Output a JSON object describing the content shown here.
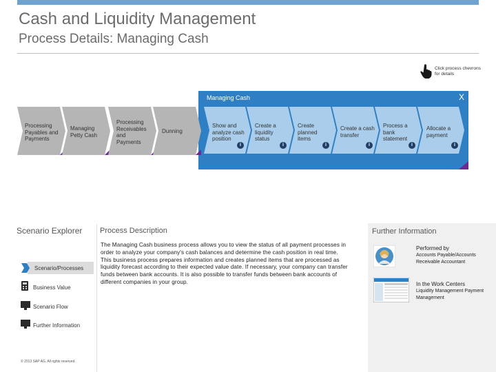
{
  "header": {
    "title": "Cash and Liquidity Management",
    "subtitle": "Process Details: Managing Cash",
    "hint": "Click process chevrons for details"
  },
  "process_band": {
    "title": "Managing Cash",
    "close": "X"
  },
  "outer_chevrons": [
    {
      "label": "Processing Payables and Payments"
    },
    {
      "label": "Managing Petty Cash"
    },
    {
      "label": "Processing Receivables and Payments"
    },
    {
      "label": "Dunning"
    }
  ],
  "inner_chevrons": [
    {
      "label": "Show and analyze cash position",
      "info": "i"
    },
    {
      "label": "Create a liquidity status",
      "info": "i"
    },
    {
      "label": "Create planned items",
      "info": "i"
    },
    {
      "label": "Create a cash transfer",
      "info": "i"
    },
    {
      "label": "Process a bank statement",
      "info": "i"
    },
    {
      "label": "Allocate a payment",
      "info": "i"
    }
  ],
  "sidebar": {
    "title": "Scenario Explorer",
    "items": [
      {
        "label": "Scenario/Processes",
        "icon": "scenario-processes-icon"
      },
      {
        "label": "Business Value",
        "icon": "calculator-icon"
      },
      {
        "label": "Scenario Flow",
        "icon": "monitor-icon"
      },
      {
        "label": "Further Information",
        "icon": "info-screen-icon"
      }
    ],
    "copyright": "© 2013 SAP AG. All rights reserved."
  },
  "description": {
    "title": "Process Description",
    "body": "The Managing Cash business process allows you to view the status of all payment processes in order to analyze your company's cash balances and determine the cash position in real time. This business process prepares information and creates planned items that are processed as liquidity forecast according to their expected value date. If necessary, your company can transfer funds between bank accounts. It is also possible to transfer funds between bank accounts of different companies in your group."
  },
  "further_info": {
    "title": "Further Information",
    "performed_by_title": "Performed by",
    "performed_by": "Accounts Payable/Accounts Receivable Accountant",
    "work_centers_title": "In the Work Centers",
    "work_centers": "Liquidity Management Payment Management"
  },
  "colors": {
    "accent": "#2f7fc4",
    "top_bar": "#6fa3cf",
    "chevron_gray": "#b5b5b5",
    "chevron_blue": "#a9cdea",
    "info_dot": "#1f3f66",
    "corner_purple": "#6a2c8e"
  }
}
